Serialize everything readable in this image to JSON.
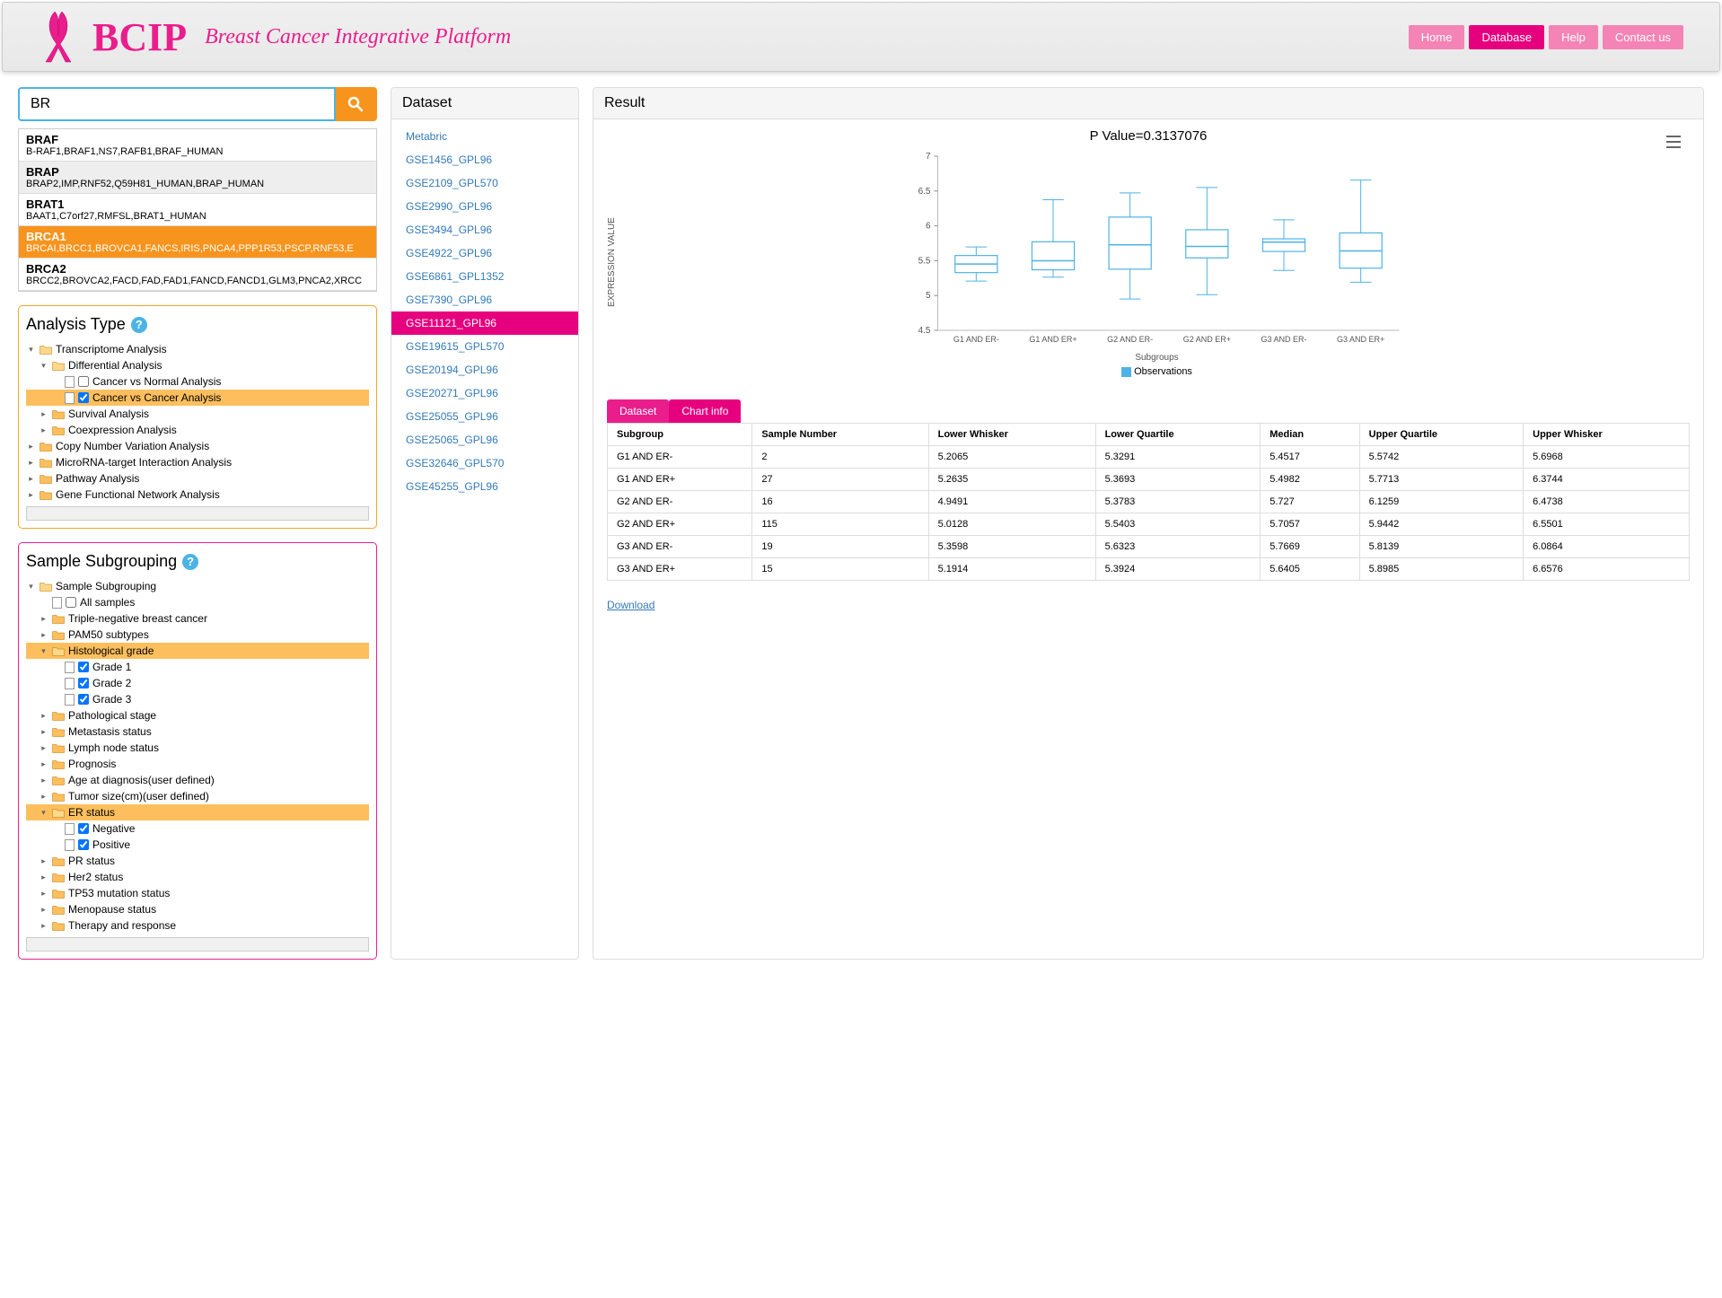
{
  "header": {
    "logo": "BCIP",
    "subtitle": "Breast Cancer Integrative Platform",
    "nav": [
      "Home",
      "Database",
      "Help",
      "Contact us"
    ],
    "active_nav": "Database"
  },
  "search": {
    "value": "BR",
    "autocomplete": [
      {
        "gene": "BRAF",
        "aliases": "B-RAF1,BRAF1,NS7,RAFB1,BRAF_HUMAN"
      },
      {
        "gene": "BRAP",
        "aliases": "BRAP2,IMP,RNF52,Q59H81_HUMAN,BRAP_HUMAN"
      },
      {
        "gene": "BRAT1",
        "aliases": "BAAT1,C7orf27,RMFSL,BRAT1_HUMAN"
      },
      {
        "gene": "BRCA1",
        "aliases": "BRCAI,BRCC1,BROVCA1,FANCS,IRIS,PNCA4,PPP1R53,PSCP,RNF53,E"
      },
      {
        "gene": "BRCA2",
        "aliases": "BRCC2,BROVCA2,FACD,FAD,FAD1,FANCD,FANCD1,GLM3,PNCA2,XRCC"
      }
    ],
    "selected_idx": 3
  },
  "analysis": {
    "title": "Analysis Type",
    "tree": [
      {
        "indent": 0,
        "toggle": "▾",
        "icon": "folder-open",
        "label": "Transcriptome Analysis"
      },
      {
        "indent": 1,
        "toggle": "▾",
        "icon": "folder-open",
        "label": "Differential Analysis"
      },
      {
        "indent": 2,
        "toggle": "",
        "icon": "page",
        "check": false,
        "label": "Cancer vs Normal Analysis"
      },
      {
        "indent": 2,
        "toggle": "",
        "icon": "page",
        "check": true,
        "label": "Cancer vs Cancer Analysis",
        "hl": true
      },
      {
        "indent": 1,
        "toggle": "▸",
        "icon": "folder",
        "label": "Survival Analysis"
      },
      {
        "indent": 1,
        "toggle": "▸",
        "icon": "folder",
        "label": "Coexpression Analysis"
      },
      {
        "indent": 0,
        "toggle": "▸",
        "icon": "folder",
        "label": "Copy Number Variation Analysis"
      },
      {
        "indent": 0,
        "toggle": "▸",
        "icon": "folder",
        "label": "MicroRNA-target Interaction Analysis"
      },
      {
        "indent": 0,
        "toggle": "▸",
        "icon": "folder",
        "label": "Pathway Analysis"
      },
      {
        "indent": 0,
        "toggle": "▸",
        "icon": "folder",
        "label": "Gene Functional Network Analysis"
      }
    ]
  },
  "subgrouping": {
    "title": "Sample Subgrouping",
    "tree": [
      {
        "indent": 0,
        "toggle": "▾",
        "icon": "folder-open",
        "label": "Sample Subgrouping"
      },
      {
        "indent": 1,
        "toggle": "",
        "icon": "page",
        "check": false,
        "label": "All samples"
      },
      {
        "indent": 1,
        "toggle": "▸",
        "icon": "folder",
        "label": "Triple-negative breast cancer"
      },
      {
        "indent": 1,
        "toggle": "▸",
        "icon": "folder",
        "label": "PAM50 subtypes"
      },
      {
        "indent": 1,
        "toggle": "▾",
        "icon": "folder-open",
        "label": "Histological grade",
        "hl": true
      },
      {
        "indent": 2,
        "toggle": "",
        "icon": "page",
        "check": true,
        "label": "Grade 1"
      },
      {
        "indent": 2,
        "toggle": "",
        "icon": "page",
        "check": true,
        "label": "Grade 2"
      },
      {
        "indent": 2,
        "toggle": "",
        "icon": "page",
        "check": true,
        "label": "Grade 3"
      },
      {
        "indent": 1,
        "toggle": "▸",
        "icon": "folder",
        "label": "Pathological stage"
      },
      {
        "indent": 1,
        "toggle": "▸",
        "icon": "folder",
        "label": "Metastasis status"
      },
      {
        "indent": 1,
        "toggle": "▸",
        "icon": "folder",
        "label": "Lymph node status"
      },
      {
        "indent": 1,
        "toggle": "▸",
        "icon": "folder",
        "label": "Prognosis"
      },
      {
        "indent": 1,
        "toggle": "▸",
        "icon": "folder",
        "label": "Age at diagnosis(user defined)"
      },
      {
        "indent": 1,
        "toggle": "▸",
        "icon": "folder",
        "label": "Tumor size(cm)(user defined)"
      },
      {
        "indent": 1,
        "toggle": "▾",
        "icon": "folder-open",
        "label": "ER status",
        "hl": true
      },
      {
        "indent": 2,
        "toggle": "",
        "icon": "page",
        "check": true,
        "label": "Negative"
      },
      {
        "indent": 2,
        "toggle": "",
        "icon": "page",
        "check": true,
        "label": "Positive"
      },
      {
        "indent": 1,
        "toggle": "▸",
        "icon": "folder",
        "label": "PR status"
      },
      {
        "indent": 1,
        "toggle": "▸",
        "icon": "folder",
        "label": "Her2 status"
      },
      {
        "indent": 1,
        "toggle": "▸",
        "icon": "folder",
        "label": "TP53 mutation status"
      },
      {
        "indent": 1,
        "toggle": "▸",
        "icon": "folder",
        "label": "Menopause status"
      },
      {
        "indent": 1,
        "toggle": "▸",
        "icon": "folder",
        "label": "Therapy and response"
      }
    ]
  },
  "datasets": {
    "title": "Dataset",
    "items": [
      "Metabric",
      "GSE1456_GPL96",
      "GSE2109_GPL570",
      "GSE2990_GPL96",
      "GSE3494_GPL96",
      "GSE4922_GPL96",
      "GSE6861_GPL1352",
      "GSE7390_GPL96",
      "GSE11121_GPL96",
      "GSE19615_GPL570",
      "GSE20194_GPL96",
      "GSE20271_GPL96",
      "GSE25055_GPL96",
      "GSE25065_GPL96",
      "GSE32646_GPL570",
      "GSE45255_GPL96"
    ],
    "active": "GSE11121_GPL96"
  },
  "result": {
    "title": "Result",
    "chart_title": "P Value=0.3137076",
    "ylabel": "EXPRESSION VALUE",
    "xlabel": "Subgroups",
    "legend": "Observations",
    "tabs": [
      "Dataset",
      "Chart info"
    ],
    "active_tab": "Dataset",
    "columns": [
      "Subgroup",
      "Sample Number",
      "Lower Whisker",
      "Lower Quartile",
      "Median",
      "Upper Quartile",
      "Upper Whisker"
    ],
    "rows": [
      [
        "G1 AND ER-",
        "2",
        "5.2065",
        "5.3291",
        "5.4517",
        "5.5742",
        "5.6968"
      ],
      [
        "G1 AND ER+",
        "27",
        "5.2635",
        "5.3693",
        "5.4982",
        "5.7713",
        "6.3744"
      ],
      [
        "G2 AND ER-",
        "16",
        "4.9491",
        "5.3783",
        "5.727",
        "6.1259",
        "6.4738"
      ],
      [
        "G2 AND ER+",
        "115",
        "5.0128",
        "5.5403",
        "5.7057",
        "5.9442",
        "6.5501"
      ],
      [
        "G3 AND ER-",
        "19",
        "5.3598",
        "5.6323",
        "5.7669",
        "5.8139",
        "6.0864"
      ],
      [
        "G3 AND ER+",
        "15",
        "5.1914",
        "5.3924",
        "5.6405",
        "5.8985",
        "6.6576"
      ]
    ],
    "download": "Download"
  },
  "chart_data": {
    "type": "boxplot",
    "title": "P Value=0.3137076",
    "xlabel": "Subgroups",
    "ylabel": "EXPRESSION VALUE",
    "ylim": [
      4.5,
      7
    ],
    "yticks": [
      4.5,
      5,
      5.5,
      6,
      6.5,
      7
    ],
    "categories": [
      "G1 AND ER-",
      "G1 AND ER+",
      "G2 AND ER-",
      "G2 AND ER+",
      "G3 AND ER-",
      "G3 AND ER+"
    ],
    "series": [
      {
        "name": "Observations",
        "boxes": [
          {
            "low": 5.2065,
            "q1": 5.3291,
            "median": 5.4517,
            "q3": 5.5742,
            "high": 5.6968
          },
          {
            "low": 5.2635,
            "q1": 5.3693,
            "median": 5.4982,
            "q3": 5.7713,
            "high": 6.3744
          },
          {
            "low": 4.9491,
            "q1": 5.3783,
            "median": 5.727,
            "q3": 6.1259,
            "high": 6.4738
          },
          {
            "low": 5.0128,
            "q1": 5.5403,
            "median": 5.7057,
            "q3": 5.9442,
            "high": 6.5501
          },
          {
            "low": 5.3598,
            "q1": 5.6323,
            "median": 5.7669,
            "q3": 5.8139,
            "high": 6.0864
          },
          {
            "low": 5.1914,
            "q1": 5.3924,
            "median": 5.6405,
            "q3": 5.8985,
            "high": 6.6576
          }
        ]
      }
    ],
    "legend": [
      "Observations"
    ]
  }
}
